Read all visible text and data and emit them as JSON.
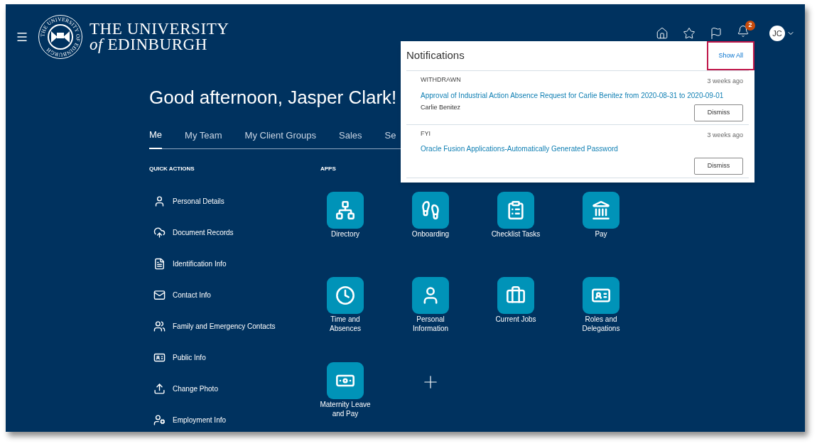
{
  "header": {
    "logo_line1": "THE UNIVERSITY",
    "logo_line2_italic": "of",
    "logo_line2": "EDINBURGH",
    "seal_text": "THE UNIVERSITY OF EDINBURGH",
    "notification_count": "2",
    "avatar_initials": "JC"
  },
  "greeting": "Good afternoon, Jasper Clark!",
  "tabs": [
    {
      "label": "Me",
      "selected": true
    },
    {
      "label": "My Team",
      "selected": false
    },
    {
      "label": "My Client Groups",
      "selected": false
    },
    {
      "label": "Sales",
      "selected": false
    },
    {
      "label": "Se",
      "selected": false
    }
  ],
  "quick_actions": {
    "heading": "QUICK ACTIONS",
    "items": [
      {
        "kind": "person",
        "label": "Personal Details"
      },
      {
        "kind": "cloud",
        "label": "Document Records"
      },
      {
        "kind": "id",
        "label": "Identification Info"
      },
      {
        "kind": "mail",
        "label": "Contact Info"
      },
      {
        "kind": "family",
        "label": "Family and Emergency Contacts"
      },
      {
        "kind": "badge",
        "label": "Public Info"
      },
      {
        "kind": "upload",
        "label": "Change Photo"
      },
      {
        "kind": "employment",
        "label": "Employment Info"
      }
    ]
  },
  "apps": {
    "heading": "APPS",
    "items": [
      {
        "kind": "directory",
        "label": "Directory"
      },
      {
        "kind": "onboarding",
        "label": "Onboarding"
      },
      {
        "kind": "checklist",
        "label": "Checklist Tasks"
      },
      {
        "kind": "pay",
        "label": "Pay"
      },
      {
        "kind": "clock",
        "label": "Time and Absences"
      },
      {
        "kind": "person",
        "label": "Personal Information"
      },
      {
        "kind": "jobs",
        "label": "Current Jobs"
      },
      {
        "kind": "badge",
        "label": "Roles and Delegations"
      },
      {
        "kind": "money",
        "label": "Maternity Leave and Pay"
      }
    ]
  },
  "notifications": {
    "title": "Notifications",
    "show_all": "Show All",
    "show_all_highlighted": true,
    "items": [
      {
        "status": "WITHDRAWN",
        "time": "3 weeks ago",
        "subject": "Approval of Industrial Action Absence Request for Carlie Benitez from 2020-08-31 to 2020-09-01",
        "from": "Carlie Benitez",
        "action": "Dismiss"
      },
      {
        "status": "FYI",
        "time": "3 weeks ago",
        "subject": "Oracle Fusion Applications-Automatically Generated Password",
        "action": "Dismiss"
      }
    ]
  }
}
